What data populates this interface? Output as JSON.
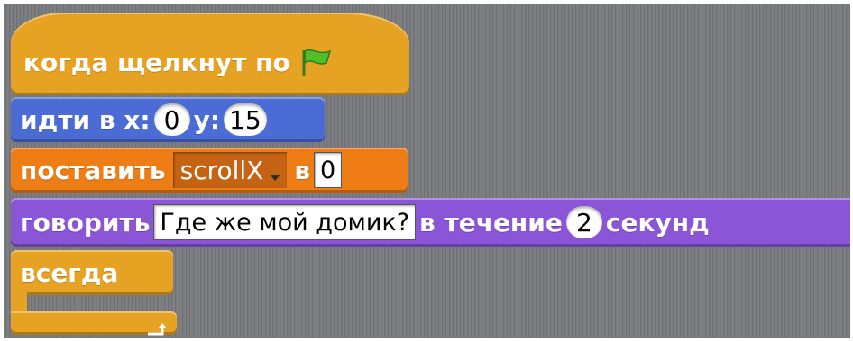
{
  "colors": {
    "events": "#e6a223",
    "motion": "#4a6cd4",
    "data": "#ee7d16",
    "looks": "#8a55d7",
    "control": "#e6a223",
    "background": "#797b7e"
  },
  "blocks": {
    "when_flag": {
      "label": "когда щелкнут по",
      "icon": "green-flag-icon"
    },
    "goto": {
      "label": "идти в x:",
      "x_value": "0",
      "y_label": "y:",
      "y_value": "15"
    },
    "set_var": {
      "label": "поставить",
      "variable": "scrollX",
      "to_label": "в",
      "value": "0"
    },
    "say": {
      "label": "говорить",
      "message": "Где же мой домик?",
      "for_label": "в течение",
      "seconds": "2",
      "unit": "секунд"
    },
    "forever": {
      "label": "всегда",
      "icon": "loop-return-icon"
    }
  }
}
